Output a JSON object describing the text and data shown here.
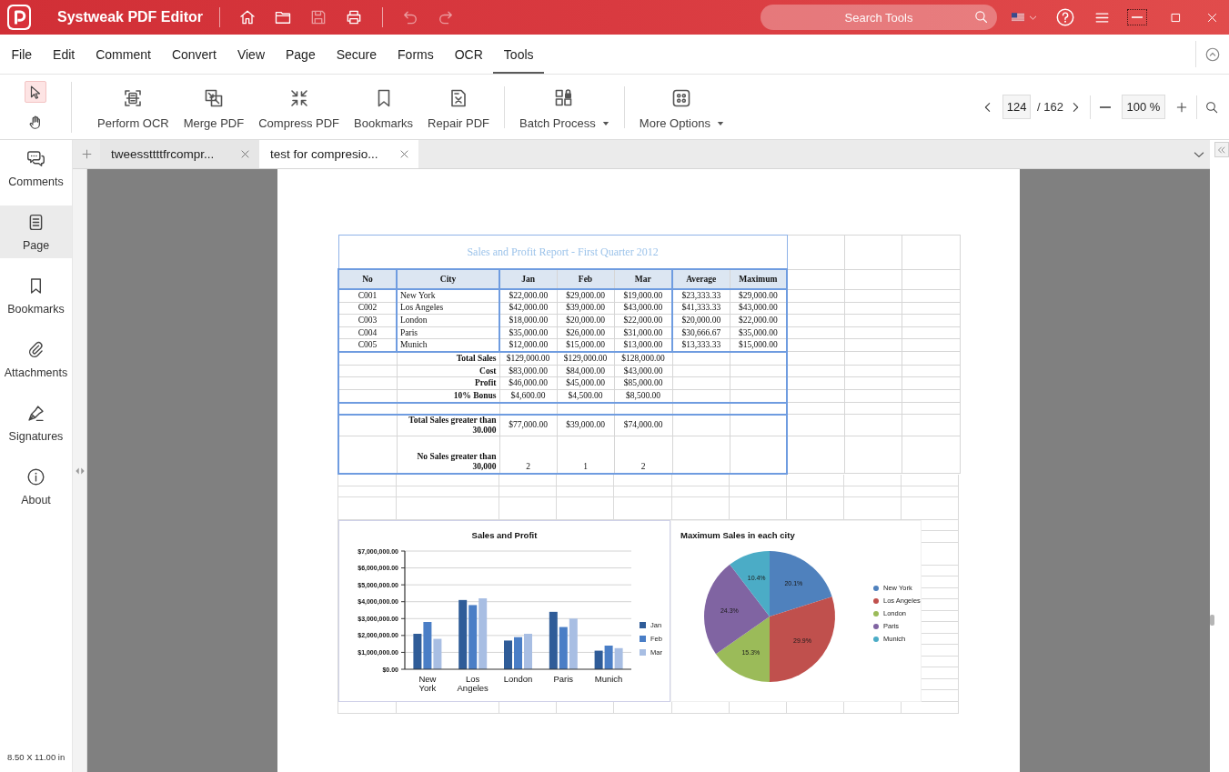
{
  "window": {
    "title": "Systweak PDF Editor"
  },
  "title_actions": [
    [
      {
        "disabled": false
      },
      {
        "disabled": false
      },
      {
        "disabled": true
      },
      {
        "disabled": false
      }
    ],
    [
      {
        "disabled": true
      },
      {
        "disabled": true
      }
    ]
  ],
  "search": {
    "placeholder": "Search Tools"
  },
  "menu": [
    {
      "label": "File",
      "selected": false
    },
    {
      "label": "Edit",
      "selected": false
    },
    {
      "label": "Comment",
      "selected": false
    },
    {
      "label": "Convert",
      "selected": false
    },
    {
      "label": "View",
      "selected": false
    },
    {
      "label": "Page",
      "selected": false
    },
    {
      "label": "Secure",
      "selected": false
    },
    {
      "label": "Forms",
      "selected": false
    },
    {
      "label": "OCR",
      "selected": false
    },
    {
      "label": "Tools",
      "selected": true
    }
  ],
  "pointer_modes": [
    {
      "selected": true
    },
    {
      "selected": false
    }
  ],
  "tool_groups": [
    [
      {
        "label": "Perform OCR",
        "dropdown": false
      },
      {
        "label": "Merge PDF",
        "dropdown": false
      },
      {
        "label": "Compress PDF",
        "dropdown": false
      },
      {
        "label": "Bookmarks",
        "dropdown": false
      },
      {
        "label": "Repair PDF",
        "dropdown": false
      }
    ],
    [
      {
        "label": "Batch Process",
        "dropdown": true
      }
    ],
    [
      {
        "label": "More Options",
        "dropdown": true
      }
    ]
  ],
  "page_nav": {
    "current": "124",
    "total": "/ 162"
  },
  "zoom": {
    "value": "100 %"
  },
  "sidebar": {
    "items": [
      {
        "label": "Comments",
        "selected": false
      },
      {
        "label": "Page",
        "selected": true
      },
      {
        "label": "Bookmarks",
        "selected": false
      },
      {
        "label": "Attachments",
        "selected": false
      },
      {
        "label": "Signatures",
        "selected": false
      },
      {
        "label": "About",
        "selected": false
      }
    ],
    "page_size": "8.50 X 11.00 in"
  },
  "tabs": [
    {
      "label": "tweessttttfrcompr...",
      "selected": false
    },
    {
      "label": "test for compresio...",
      "selected": true
    }
  ],
  "document": {
    "report": {
      "title": "Sales and Profit Report - First Quarter 2012",
      "columns": [
        "No",
        "City",
        "Jan",
        "Feb",
        "Mar",
        "Average",
        "Maximum"
      ],
      "rows": [
        [
          "C001",
          "New York",
          "$22,000.00",
          "$29,000.00",
          "$19,000.00",
          "$23,333.33",
          "$29,000.00"
        ],
        [
          "C002",
          "Los Angeles",
          "$42,000.00",
          "$39,000.00",
          "$43,000.00",
          "$41,333.33",
          "$43,000.00"
        ],
        [
          "C003",
          "London",
          "$18,000.00",
          "$20,000.00",
          "$22,000.00",
          "$20,000.00",
          "$22,000.00"
        ],
        [
          "C004",
          "Paris",
          "$35,000.00",
          "$26,000.00",
          "$31,000.00",
          "$30,666.67",
          "$35,000.00"
        ],
        [
          "C005",
          "Munich",
          "$12,000.00",
          "$15,000.00",
          "$13,000.00",
          "$13,333.33",
          "$15,000.00"
        ]
      ],
      "summary": [
        {
          "label": "Total Sales",
          "values": [
            "$129,000.00",
            "$129,000.00",
            "$128,000.00"
          ]
        },
        {
          "label": "Cost",
          "values": [
            "$83,000.00",
            "$84,000.00",
            "$43,000.00"
          ]
        },
        {
          "label": "Profit",
          "values": [
            "$46,000.00",
            "$45,000.00",
            "$85,000.00"
          ]
        },
        {
          "label": "10% Bonus",
          "values": [
            "$4,600.00",
            "$4,500.00",
            "$8,500.00"
          ]
        }
      ],
      "counts": [
        {
          "label": "Total Sales greater than 30.000",
          "values": [
            "$77,000.00",
            "$39,000.00",
            "$74,000.00"
          ]
        },
        {
          "label": "No Sales greater than 30,000",
          "values": [
            "2",
            "1",
            "2"
          ]
        }
      ]
    },
    "charts": [
      {
        "chart_data": {
          "type": "bar",
          "title": "Sales and Profit",
          "categories": [
            "New York",
            "Los Angeles",
            "London",
            "Paris",
            "Munich"
          ],
          "series": [
            {
              "name": "Jan",
              "color": "#2f5c98",
              "values": [
                2100000,
                4100000,
                1700000,
                3400000,
                1100000
              ]
            },
            {
              "name": "Feb",
              "color": "#4a7ec6",
              "values": [
                2800000,
                3800000,
                1900000,
                2500000,
                1400000
              ]
            },
            {
              "name": "Mar",
              "color": "#a8bee3",
              "values": [
                1800000,
                4200000,
                2100000,
                3000000,
                1250000
              ]
            }
          ],
          "ylim": [
            0,
            7000000
          ],
          "yticks": [
            {
              "value": 0,
              "label": "$0.00"
            },
            {
              "value": 1000000,
              "label": "$1,000,000.00"
            },
            {
              "value": 2000000,
              "label": "$2,000,000.00"
            },
            {
              "value": 3000000,
              "label": "$3,000,000.00"
            },
            {
              "value": 4000000,
              "label": "$4,000,000.00"
            },
            {
              "value": 5000000,
              "label": "$5,000,000.00"
            },
            {
              "value": 6000000,
              "label": "$6,000,000.00"
            },
            {
              "value": 7000000,
              "label": "$7,000,000.00"
            }
          ],
          "grid": true,
          "legend": "right"
        }
      },
      {
        "chart_data": {
          "type": "pie",
          "title": "Maximum Sales in each city",
          "categories": [
            "New York",
            "Los Angeles",
            "London",
            "Paris",
            "Munich"
          ],
          "values": [
            20.1,
            29.9,
            15.3,
            24.3,
            10.4
          ],
          "colors": [
            "#4f81bd",
            "#c0504d",
            "#9bbb59",
            "#8064a2",
            "#4bacc6"
          ],
          "value_labels": [
            "20.1%",
            "29.9%",
            "15.3%",
            "24.3%",
            "10.4%"
          ],
          "legend": "right"
        }
      }
    ]
  }
}
